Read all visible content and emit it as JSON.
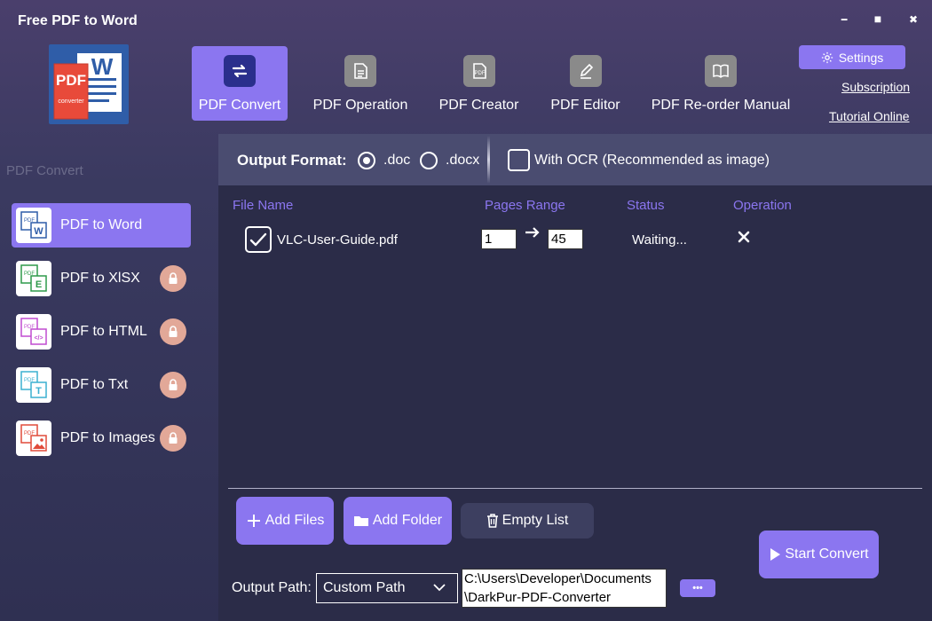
{
  "window": {
    "title": "Free PDF to Word",
    "minimize_glyph": "━",
    "maximize_glyph": "■",
    "close_glyph": "✖"
  },
  "logo": {
    "top_text": "PDF",
    "side_text": "W",
    "sub_text": "converter"
  },
  "topnav": {
    "items": [
      {
        "label": "PDF Convert",
        "icon": "swap-arrows-icon",
        "active": true
      },
      {
        "label": "PDF Operation",
        "icon": "document-icon",
        "active": false
      },
      {
        "label": "PDF Creator",
        "icon": "pdf-file-icon",
        "active": false
      },
      {
        "label": "PDF Editor",
        "icon": "pencil-icon",
        "active": false
      },
      {
        "label": "PDF Re-order Manual",
        "icon": "book-icon",
        "active": false
      }
    ],
    "settings_label": "Settings",
    "subscription_label": "Subscription",
    "tutorial_label": "Tutorial Online"
  },
  "sidebar": {
    "heading": "PDF Convert",
    "items": [
      {
        "label": "PDF to Word",
        "badge": "W",
        "badge_color": "#2f5da8",
        "locked": false,
        "active": true
      },
      {
        "label": "PDF to XlSX",
        "badge": "E",
        "badge_color": "#2e9a4a",
        "locked": true,
        "active": false
      },
      {
        "label": "PDF to HTML",
        "badge": "</>",
        "badge_color": "#c04bd0",
        "locked": true,
        "active": false
      },
      {
        "label": "PDF to Txt",
        "badge": "T",
        "badge_color": "#3bb0d0",
        "locked": true,
        "active": false
      },
      {
        "label": "PDF to Images",
        "badge": "img",
        "badge_color": "#e04b3a",
        "locked": true,
        "active": false
      }
    ]
  },
  "output_format": {
    "title": "Output Format:",
    "options": [
      ".doc",
      ".docx"
    ],
    "selected": ".doc",
    "ocr_label": "With OCR (Recommended as image)",
    "ocr_checked": false
  },
  "table": {
    "columns": [
      "File Name",
      "Pages Range",
      "Status",
      "Operation"
    ],
    "rows": [
      {
        "file_name": "VLC-User-Guide.pdf",
        "page_from": "1",
        "page_to": "45",
        "status": "Waiting...",
        "checked": true
      }
    ]
  },
  "actions": {
    "add_files": "Add Files",
    "add_folder": "Add Folder",
    "empty_list": "Empty List",
    "start_convert": "Start Convert"
  },
  "output_path": {
    "label": "Output Path:",
    "mode": "Custom Path",
    "line1": "C:\\Users\\Developer\\Documents",
    "line2": "\\DarkPur-PDF-Converter",
    "more_label": "•••"
  },
  "colors": {
    "accent": "#8b76f0",
    "background": "#2b2c48",
    "format_bar": "#4a4c70",
    "lock_badge": "#e2a898"
  }
}
